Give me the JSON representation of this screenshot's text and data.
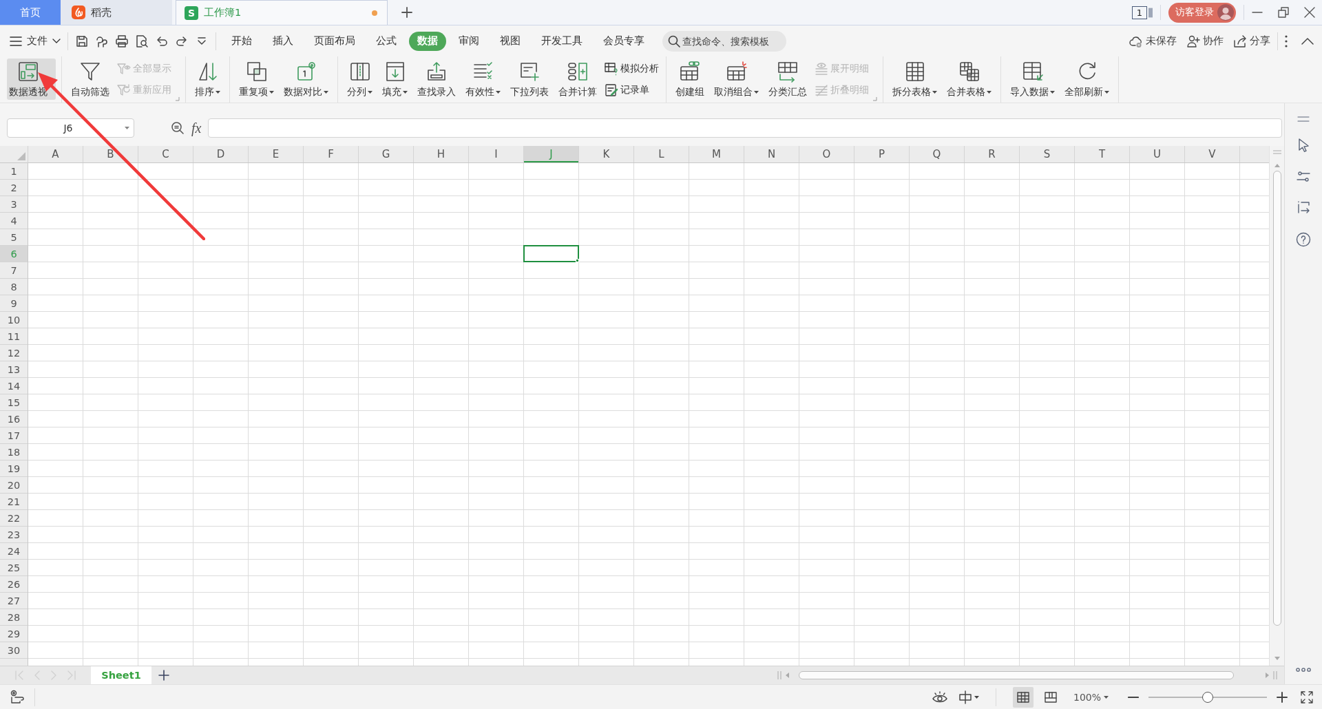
{
  "tabs": [
    {
      "kind": "home",
      "label": "首页",
      "selected": false,
      "modified": false
    },
    {
      "kind": "docer",
      "label": "稻壳",
      "selected": false,
      "modified": false
    },
    {
      "kind": "sheet",
      "label": "工作簿1",
      "logo": "S",
      "selected": true,
      "modified": true
    }
  ],
  "title_bar": {
    "window_count": "1",
    "login": "访客登录"
  },
  "menu_bar": {
    "file": "文件",
    "tabs": [
      {
        "label": "开始",
        "selected": false
      },
      {
        "label": "插入",
        "selected": false
      },
      {
        "label": "页面布局",
        "selected": false
      },
      {
        "label": "公式",
        "selected": false
      },
      {
        "label": "数据",
        "selected": true
      },
      {
        "label": "审阅",
        "selected": false
      },
      {
        "label": "视图",
        "selected": false
      },
      {
        "label": "开发工具",
        "selected": false
      },
      {
        "label": "会员专享",
        "selected": false
      }
    ],
    "search": {
      "placeholder": "查找命令、搜索模板"
    },
    "actions": [
      "未保存",
      "协作",
      "分享"
    ]
  },
  "ribbon": {
    "groups": [
      {
        "launcher": false,
        "items": [
          {
            "label": "数据透视",
            "kind": "large",
            "dropdown": false,
            "disabled": false,
            "highlighted": true
          }
        ]
      },
      {
        "launcher": true,
        "items": [
          {
            "label": "自动筛选",
            "kind": "large",
            "dropdown": false,
            "disabled": false,
            "highlighted": false
          },
          {
            "label": "全部显示",
            "kind": "small",
            "dropdown": false,
            "disabled": true,
            "highlighted": false
          },
          {
            "label": "重新应用",
            "kind": "small",
            "dropdown": false,
            "disabled": true,
            "highlighted": false
          }
        ]
      },
      {
        "launcher": false,
        "items": [
          {
            "label": "排序",
            "kind": "large",
            "dropdown": true,
            "disabled": false,
            "highlighted": false
          }
        ]
      },
      {
        "launcher": false,
        "items": [
          {
            "label": "重复项",
            "kind": "large",
            "dropdown": true,
            "disabled": false,
            "highlighted": false
          },
          {
            "label": "数据对比",
            "kind": "large",
            "dropdown": true,
            "disabled": false,
            "highlighted": false
          }
        ]
      },
      {
        "launcher": false,
        "items": [
          {
            "label": "分列",
            "kind": "large",
            "dropdown": true,
            "disabled": false,
            "highlighted": false
          },
          {
            "label": "填充",
            "kind": "large",
            "dropdown": true,
            "disabled": false,
            "highlighted": false
          },
          {
            "label": "查找录入",
            "kind": "large",
            "dropdown": false,
            "disabled": false,
            "highlighted": false
          },
          {
            "label": "有效性",
            "kind": "large",
            "dropdown": true,
            "disabled": false,
            "highlighted": false
          },
          {
            "label": "下拉列表",
            "kind": "large",
            "dropdown": false,
            "disabled": false,
            "highlighted": false
          },
          {
            "label": "合并计算",
            "kind": "large",
            "dropdown": false,
            "disabled": false,
            "highlighted": false
          },
          {
            "label": "模拟分析",
            "kind": "small",
            "dropdown": false,
            "disabled": false,
            "highlighted": false
          },
          {
            "label": "记录单",
            "kind": "small",
            "dropdown": false,
            "disabled": false,
            "highlighted": false
          }
        ]
      },
      {
        "launcher": true,
        "items": [
          {
            "label": "创建组",
            "kind": "large",
            "dropdown": false,
            "disabled": false,
            "highlighted": false
          },
          {
            "label": "取消组合",
            "kind": "large",
            "dropdown": true,
            "disabled": false,
            "highlighted": false
          },
          {
            "label": "分类汇总",
            "kind": "large",
            "dropdown": false,
            "disabled": false,
            "highlighted": false
          },
          {
            "label": "展开明细",
            "kind": "small",
            "dropdown": false,
            "disabled": true,
            "highlighted": false
          },
          {
            "label": "折叠明细",
            "kind": "small",
            "dropdown": false,
            "disabled": true,
            "highlighted": false
          }
        ]
      },
      {
        "launcher": false,
        "items": [
          {
            "label": "拆分表格",
            "kind": "large",
            "dropdown": true,
            "disabled": false,
            "highlighted": false
          },
          {
            "label": "合并表格",
            "kind": "large",
            "dropdown": true,
            "disabled": false,
            "highlighted": false
          }
        ]
      },
      {
        "launcher": false,
        "items": [
          {
            "label": "导入数据",
            "kind": "large",
            "dropdown": true,
            "disabled": false,
            "highlighted": false
          },
          {
            "label": "全部刷新",
            "kind": "large",
            "dropdown": true,
            "disabled": false,
            "highlighted": false
          }
        ]
      }
    ]
  },
  "formula_bar": {
    "name_box": "J6",
    "function_label": "fx"
  },
  "sheet": {
    "columns": [
      {
        "label": "A",
        "selected": false
      },
      {
        "label": "B",
        "selected": false
      },
      {
        "label": "C",
        "selected": false
      },
      {
        "label": "D",
        "selected": false
      },
      {
        "label": "E",
        "selected": false
      },
      {
        "label": "F",
        "selected": false
      },
      {
        "label": "G",
        "selected": false
      },
      {
        "label": "H",
        "selected": false
      },
      {
        "label": "I",
        "selected": false
      },
      {
        "label": "J",
        "selected": true
      },
      {
        "label": "K",
        "selected": false
      },
      {
        "label": "L",
        "selected": false
      },
      {
        "label": "M",
        "selected": false
      },
      {
        "label": "N",
        "selected": false
      },
      {
        "label": "O",
        "selected": false
      },
      {
        "label": "P",
        "selected": false
      },
      {
        "label": "Q",
        "selected": false
      },
      {
        "label": "R",
        "selected": false
      },
      {
        "label": "S",
        "selected": false
      },
      {
        "label": "T",
        "selected": false
      },
      {
        "label": "U",
        "selected": false
      },
      {
        "label": "V",
        "selected": false
      }
    ],
    "rows": [
      {
        "label": "1",
        "selected": false
      },
      {
        "label": "2",
        "selected": false
      },
      {
        "label": "3",
        "selected": false
      },
      {
        "label": "4",
        "selected": false
      },
      {
        "label": "5",
        "selected": false
      },
      {
        "label": "6",
        "selected": true
      },
      {
        "label": "7",
        "selected": false
      },
      {
        "label": "8",
        "selected": false
      },
      {
        "label": "9",
        "selected": false
      },
      {
        "label": "10",
        "selected": false
      },
      {
        "label": "11",
        "selected": false
      },
      {
        "label": "12",
        "selected": false
      },
      {
        "label": "13",
        "selected": false
      },
      {
        "label": "14",
        "selected": false
      },
      {
        "label": "15",
        "selected": false
      },
      {
        "label": "16",
        "selected": false
      },
      {
        "label": "17",
        "selected": false
      },
      {
        "label": "18",
        "selected": false
      },
      {
        "label": "19",
        "selected": false
      },
      {
        "label": "20",
        "selected": false
      },
      {
        "label": "21",
        "selected": false
      },
      {
        "label": "22",
        "selected": false
      },
      {
        "label": "23",
        "selected": false
      },
      {
        "label": "24",
        "selected": false
      },
      {
        "label": "25",
        "selected": false
      },
      {
        "label": "26",
        "selected": false
      },
      {
        "label": "27",
        "selected": false
      },
      {
        "label": "28",
        "selected": false
      },
      {
        "label": "29",
        "selected": false
      },
      {
        "label": "30",
        "selected": false
      }
    ]
  },
  "sheet_bar": {
    "nav_disabled": true,
    "tabs": [
      {
        "label": "Sheet1",
        "selected": true
      }
    ]
  },
  "status_bar": {
    "views": [
      {
        "selected": true
      },
      {
        "selected": false
      }
    ],
    "zoom": {
      "label": "100%",
      "level": 0.5
    }
  }
}
